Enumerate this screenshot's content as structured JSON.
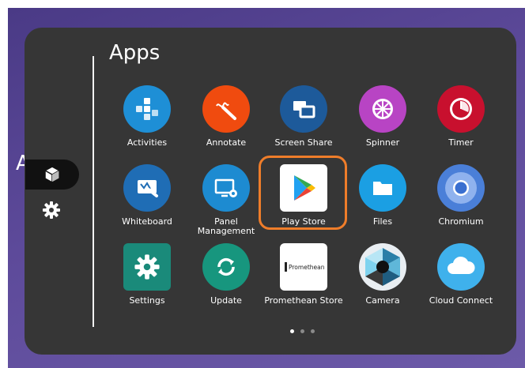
{
  "launcher": {
    "title": "Apps",
    "apps": [
      {
        "label": "Activities",
        "icon": "activities-icon"
      },
      {
        "label": "Annotate",
        "icon": "annotate-icon"
      },
      {
        "label": "Screen Share",
        "icon": "screen-share-icon"
      },
      {
        "label": "Spinner",
        "icon": "spinner-icon"
      },
      {
        "label": "Timer",
        "icon": "timer-icon"
      },
      {
        "label": "Whiteboard",
        "icon": "whiteboard-icon"
      },
      {
        "label": "Panel Management",
        "icon": "panel-management-icon"
      },
      {
        "label": "Play Store",
        "icon": "play-store-icon",
        "highlighted": true
      },
      {
        "label": "Files",
        "icon": "files-icon"
      },
      {
        "label": "Chromium",
        "icon": "chromium-icon"
      },
      {
        "label": "Settings",
        "icon": "settings-icon"
      },
      {
        "label": "Update",
        "icon": "update-icon"
      },
      {
        "label": "Promethean Store",
        "icon": "promethean-store-icon"
      },
      {
        "label": "Camera",
        "icon": "camera-icon"
      },
      {
        "label": "Cloud Connect",
        "icon": "cloud-connect-icon"
      }
    ],
    "pager": {
      "pages": 3,
      "current": 1
    }
  },
  "sidebar": {
    "items": [
      {
        "icon": "apps-cube-icon",
        "selected": true
      },
      {
        "icon": "gear-icon",
        "selected": false
      }
    ]
  },
  "promethean_logo_text": "Promethean",
  "colors": {
    "highlight": "#ef7d2a",
    "panel": "#363636",
    "activities": "#1e8fd6",
    "annotate": "#f04b0f",
    "screen_share": "#1d5a9a",
    "spinner": "#b844c4",
    "timer": "#c8102e",
    "whiteboard": "#1f6db5",
    "panel_management": "#1d8bd1",
    "files": "#1b9fe3",
    "chromium": "#4a7fd8",
    "settings": "#1a8a7a",
    "update": "#17967e",
    "cloud_connect": "#3fb1ec"
  }
}
